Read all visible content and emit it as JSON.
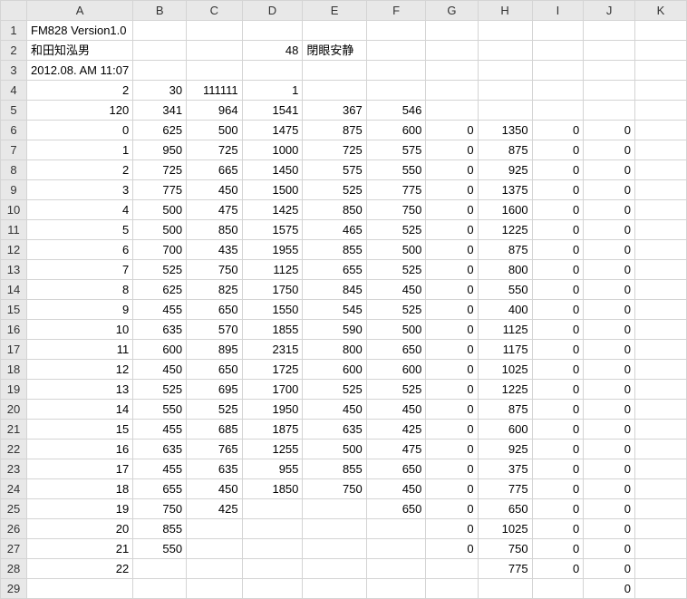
{
  "chart_data": {
    "type": "table",
    "title": "FM828 Version1.0",
    "columns": [
      "A",
      "B",
      "C",
      "D",
      "E",
      "F",
      "G",
      "H",
      "I",
      "J",
      "K"
    ],
    "rows": [
      [
        "FM828 Version1.0",
        "",
        "",
        "",
        "",
        "",
        "",
        "",
        "",
        "",
        ""
      ],
      [
        "和田知泓男",
        "",
        "",
        "48",
        "閉眼安静",
        "",
        "",
        "",
        "",
        "",
        ""
      ],
      [
        "2012.08. AM 11:07",
        "",
        "",
        "",
        "",
        "",
        "",
        "",
        "",
        "",
        ""
      ],
      [
        "2",
        "30",
        "111111",
        "1",
        "",
        "",
        "",
        "",
        "",
        "",
        ""
      ],
      [
        "120",
        "341",
        "964",
        "1541",
        "367",
        "546",
        "",
        "",
        "",
        "",
        ""
      ],
      [
        "0",
        "625",
        "500",
        "1475",
        "875",
        "600",
        "0",
        "1350",
        "0",
        "0",
        ""
      ],
      [
        "1",
        "950",
        "725",
        "1000",
        "725",
        "575",
        "0",
        "875",
        "0",
        "0",
        ""
      ],
      [
        "2",
        "725",
        "665",
        "1450",
        "575",
        "550",
        "0",
        "925",
        "0",
        "0",
        ""
      ],
      [
        "3",
        "775",
        "450",
        "1500",
        "525",
        "775",
        "0",
        "1375",
        "0",
        "0",
        ""
      ],
      [
        "4",
        "500",
        "475",
        "1425",
        "850",
        "750",
        "0",
        "1600",
        "0",
        "0",
        ""
      ],
      [
        "5",
        "500",
        "850",
        "1575",
        "465",
        "525",
        "0",
        "1225",
        "0",
        "0",
        ""
      ],
      [
        "6",
        "700",
        "435",
        "1955",
        "855",
        "500",
        "0",
        "875",
        "0",
        "0",
        ""
      ],
      [
        "7",
        "525",
        "750",
        "1125",
        "655",
        "525",
        "0",
        "800",
        "0",
        "0",
        ""
      ],
      [
        "8",
        "625",
        "825",
        "1750",
        "845",
        "450",
        "0",
        "550",
        "0",
        "0",
        ""
      ],
      [
        "9",
        "455",
        "650",
        "1550",
        "545",
        "525",
        "0",
        "400",
        "0",
        "0",
        ""
      ],
      [
        "10",
        "635",
        "570",
        "1855",
        "590",
        "500",
        "0",
        "1125",
        "0",
        "0",
        ""
      ],
      [
        "11",
        "600",
        "895",
        "2315",
        "800",
        "650",
        "0",
        "1175",
        "0",
        "0",
        ""
      ],
      [
        "12",
        "450",
        "650",
        "1725",
        "600",
        "600",
        "0",
        "1025",
        "0",
        "0",
        ""
      ],
      [
        "13",
        "525",
        "695",
        "1700",
        "525",
        "525",
        "0",
        "1225",
        "0",
        "0",
        ""
      ],
      [
        "14",
        "550",
        "525",
        "1950",
        "450",
        "450",
        "0",
        "875",
        "0",
        "0",
        ""
      ],
      [
        "15",
        "455",
        "685",
        "1875",
        "635",
        "425",
        "0",
        "600",
        "0",
        "0",
        ""
      ],
      [
        "16",
        "635",
        "765",
        "1255",
        "500",
        "475",
        "0",
        "925",
        "0",
        "0",
        ""
      ],
      [
        "17",
        "455",
        "635",
        "955",
        "855",
        "650",
        "0",
        "375",
        "0",
        "0",
        ""
      ],
      [
        "18",
        "655",
        "450",
        "1850",
        "750",
        "450",
        "0",
        "775",
        "0",
        "0",
        ""
      ],
      [
        "19",
        "750",
        "425",
        "",
        "",
        "650",
        "0",
        "650",
        "0",
        "0",
        ""
      ],
      [
        "20",
        "855",
        "",
        "",
        "",
        "",
        "0",
        "1025",
        "0",
        "0",
        ""
      ],
      [
        "21",
        "550",
        "",
        "",
        "",
        "",
        "0",
        "750",
        "0",
        "0",
        ""
      ],
      [
        "22",
        "",
        "",
        "",
        "",
        "",
        "",
        "775",
        "0",
        "0",
        ""
      ],
      [
        "",
        "",
        "",
        "",
        "",
        "",
        "",
        "",
        "",
        "0",
        ""
      ]
    ]
  },
  "text_cells": {
    "r1cA": true,
    "r2cA": true,
    "r2cE": true,
    "r3cA": true
  }
}
